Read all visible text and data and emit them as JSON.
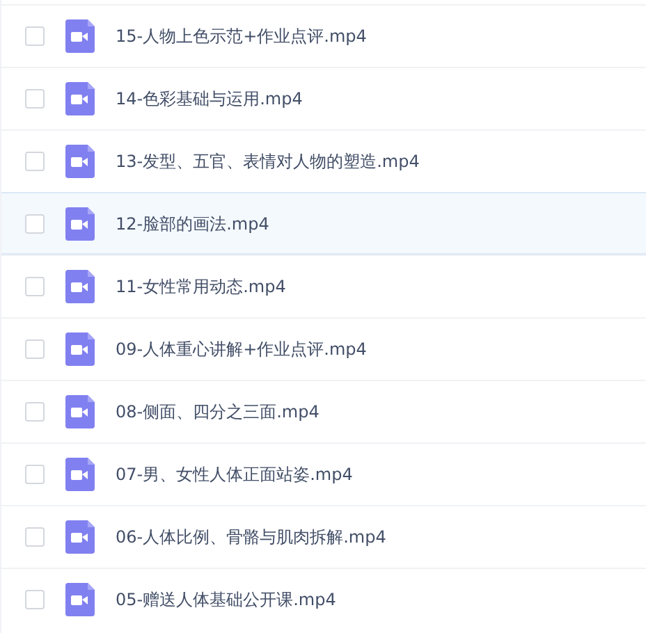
{
  "files": [
    {
      "name": "15-人物上色示范+作业点评.mp4",
      "checked": false,
      "selected": false
    },
    {
      "name": "14-色彩基础与运用.mp4",
      "checked": false,
      "selected": false
    },
    {
      "name": "13-发型、五官、表情对人物的塑造.mp4",
      "checked": false,
      "selected": false
    },
    {
      "name": "12-脸部的画法.mp4",
      "checked": false,
      "selected": true
    },
    {
      "name": "11-女性常用动态.mp4",
      "checked": false,
      "selected": false
    },
    {
      "name": "09-人体重心讲解+作业点评.mp4",
      "checked": false,
      "selected": false
    },
    {
      "name": "08-侧面、四分之三面.mp4",
      "checked": false,
      "selected": false
    },
    {
      "name": "07-男、女性人体正面站姿.mp4",
      "checked": false,
      "selected": false
    },
    {
      "name": "06-人体比例、骨骼与肌肉拆解.mp4",
      "checked": false,
      "selected": false
    },
    {
      "name": "05-赠送人体基础公开课.mp4",
      "checked": false,
      "selected": false
    }
  ]
}
